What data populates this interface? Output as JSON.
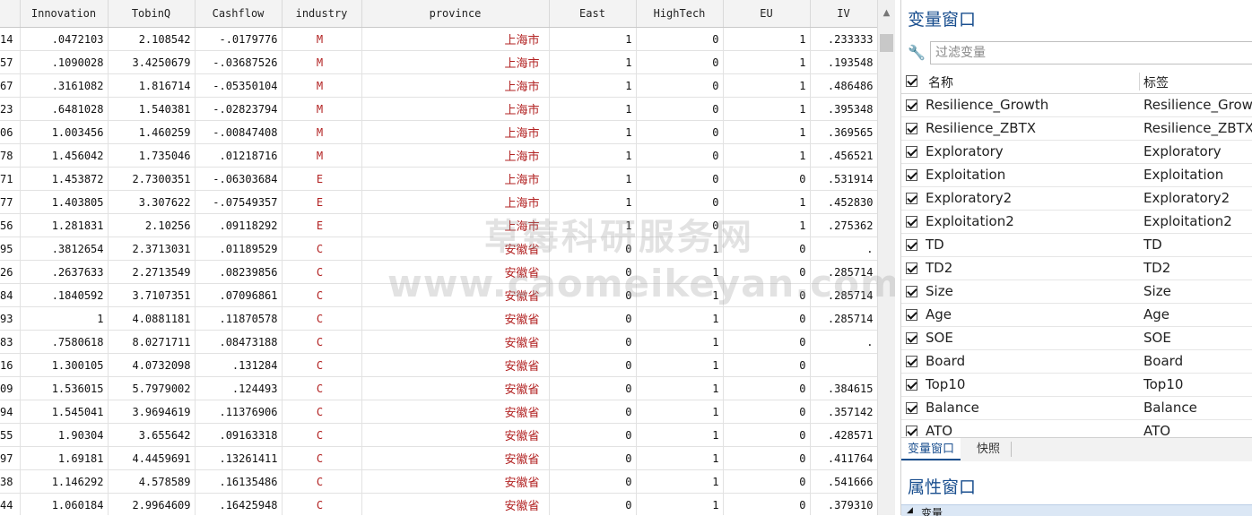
{
  "grid": {
    "columns": [
      {
        "key": "id",
        "label": ""
      },
      {
        "key": "innovation",
        "label": "Innovation"
      },
      {
        "key": "tobinq",
        "label": "TobinQ"
      },
      {
        "key": "cashflow",
        "label": "Cashflow"
      },
      {
        "key": "industry",
        "label": "industry"
      },
      {
        "key": "province",
        "label": "province"
      },
      {
        "key": "east",
        "label": "East"
      },
      {
        "key": "hightech",
        "label": "HighTech"
      },
      {
        "key": "eu",
        "label": "EU"
      },
      {
        "key": "iv",
        "label": "IV"
      }
    ],
    "rows": [
      [
        "14",
        ".0472103",
        "2.108542",
        "-.0179776",
        "M",
        "上海市",
        "1",
        "0",
        "1",
        ".233333"
      ],
      [
        "57",
        ".1090028",
        "3.4250679",
        "-.03687526",
        "M",
        "上海市",
        "1",
        "0",
        "1",
        ".193548"
      ],
      [
        "67",
        ".3161082",
        "1.816714",
        "-.05350104",
        "M",
        "上海市",
        "1",
        "0",
        "1",
        ".486486"
      ],
      [
        "23",
        ".6481028",
        "1.540381",
        "-.02823794",
        "M",
        "上海市",
        "1",
        "0",
        "1",
        ".395348"
      ],
      [
        "06",
        "1.003456",
        "1.460259",
        "-.00847408",
        "M",
        "上海市",
        "1",
        "0",
        "1",
        ".369565"
      ],
      [
        "78",
        "1.456042",
        "1.735046",
        ".01218716",
        "M",
        "上海市",
        "1",
        "0",
        "1",
        ".456521"
      ],
      [
        "71",
        "1.453872",
        "2.7300351",
        "-.06303684",
        "E",
        "上海市",
        "1",
        "0",
        "0",
        ".531914"
      ],
      [
        "77",
        "1.403805",
        "3.307622",
        "-.07549357",
        "E",
        "上海市",
        "1",
        "0",
        "1",
        ".452830"
      ],
      [
        "56",
        "1.281831",
        "2.10256",
        ".09118292",
        "E",
        "上海市",
        "1",
        "0",
        "1",
        ".275362"
      ],
      [
        "95",
        ".3812654",
        "2.3713031",
        ".01189529",
        "C",
        "安徽省",
        "0",
        "1",
        "0",
        "."
      ],
      [
        "26",
        ".2637633",
        "2.2713549",
        ".08239856",
        "C",
        "安徽省",
        "0",
        "1",
        "0",
        ".285714"
      ],
      [
        "84",
        ".1840592",
        "3.7107351",
        ".07096861",
        "C",
        "安徽省",
        "0",
        "1",
        "0",
        ".285714"
      ],
      [
        "93",
        "1",
        "4.0881181",
        ".11870578",
        "C",
        "安徽省",
        "0",
        "1",
        "0",
        ".285714"
      ],
      [
        "83",
        ".7580618",
        "8.0271711",
        ".08473188",
        "C",
        "安徽省",
        "0",
        "1",
        "0",
        "."
      ],
      [
        "16",
        "1.300105",
        "4.0732098",
        ".131284",
        "C",
        "安徽省",
        "0",
        "1",
        "0",
        ""
      ],
      [
        "09",
        "1.536015",
        "5.7979002",
        ".124493",
        "C",
        "安徽省",
        "0",
        "1",
        "0",
        ".384615"
      ],
      [
        "94",
        "1.545041",
        "3.9694619",
        ".11376906",
        "C",
        "安徽省",
        "0",
        "1",
        "0",
        ".357142"
      ],
      [
        "55",
        "1.90304",
        "3.655642",
        ".09163318",
        "C",
        "安徽省",
        "0",
        "1",
        "0",
        ".428571"
      ],
      [
        "97",
        "1.69181",
        "4.4459691",
        ".13261411",
        "C",
        "安徽省",
        "0",
        "1",
        "0",
        ".411764"
      ],
      [
        "38",
        "1.146292",
        "4.578589",
        ".16135486",
        "C",
        "安徽省",
        "0",
        "1",
        "0",
        ".541666"
      ],
      [
        "44",
        "1.060184",
        "2.9964609",
        ".16425948",
        "C",
        "安徽省",
        "0",
        "1",
        "0",
        ".379310"
      ]
    ]
  },
  "watermark": {
    "line1": "草莓科研服务网",
    "line2": "www.caomeikeyan.com"
  },
  "variables_window": {
    "title": "变量窗口",
    "filter_placeholder": "过滤变量",
    "header_name": "名称",
    "header_label": "标签",
    "variables": [
      {
        "name": "Resilience_Growth",
        "label": "Resilience_Growth"
      },
      {
        "name": "Resilience_ZBTX",
        "label": "Resilience_ZBTX"
      },
      {
        "name": "Exploratory",
        "label": "Exploratory"
      },
      {
        "name": "Exploitation",
        "label": "Exploitation"
      },
      {
        "name": "Exploratory2",
        "label": "Exploratory2"
      },
      {
        "name": "Exploitation2",
        "label": "Exploitation2"
      },
      {
        "name": "TD",
        "label": "TD"
      },
      {
        "name": "TD2",
        "label": "TD2"
      },
      {
        "name": "Size",
        "label": "Size"
      },
      {
        "name": "Age",
        "label": "Age"
      },
      {
        "name": "SOE",
        "label": "SOE"
      },
      {
        "name": "Board",
        "label": "Board"
      },
      {
        "name": "Top10",
        "label": "Top10"
      },
      {
        "name": "Balance",
        "label": "Balance"
      },
      {
        "name": "ATO",
        "label": "ATO"
      }
    ]
  },
  "tabs": {
    "varwin": "变量窗口",
    "snapshot": "快照"
  },
  "properties_window": {
    "title": "属性窗口",
    "section": "变量"
  },
  "icons": {
    "filter": "wrench-icon",
    "scroll_up": "chevron-up-icon",
    "collapse": "caret-down-icon"
  }
}
